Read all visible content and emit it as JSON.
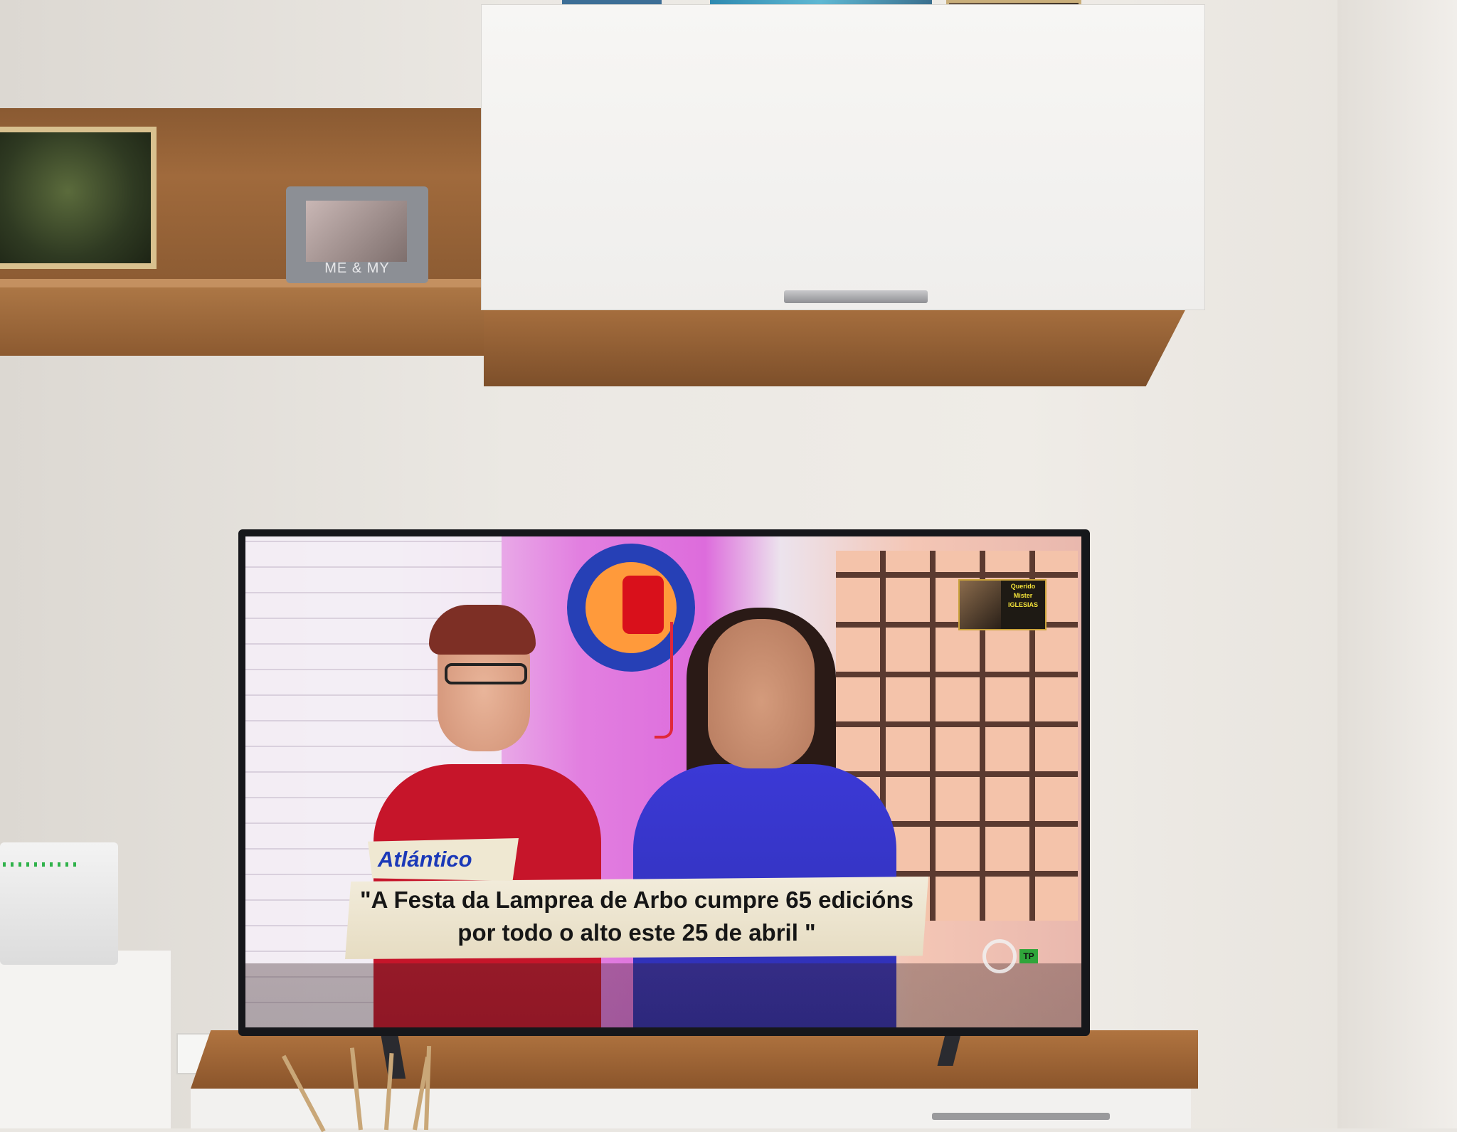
{
  "shelf": {
    "photo_frame_caption": "ME & MY"
  },
  "tv": {
    "channel_brand": "Atlántico",
    "headline_line1": "\"A Festa da Lamprea de Arbo cumpre 65 edicións",
    "headline_line2": "por todo o alto este 25 de abril \"",
    "promo_inset_text": "Querido Mister IGLESIAS",
    "rating_badge": "TP",
    "channel_logo_icon": "galicia-channel-logo-icon"
  },
  "colors": {
    "headline_text": "#161616",
    "brand_text": "#1b39b8",
    "lower_third_bg": "#efe8d2",
    "tp_badge": "#2fa53a",
    "wood": "#a06a3c",
    "cabinet_white": "#f7f6f4"
  }
}
